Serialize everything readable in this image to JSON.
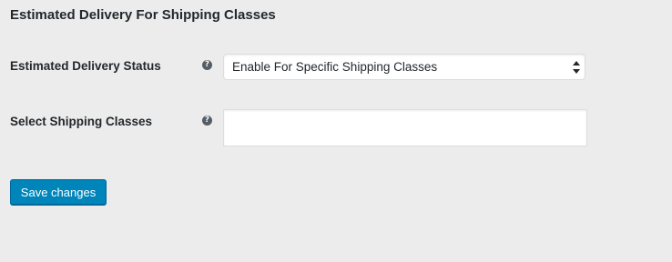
{
  "section": {
    "title": "Estimated Delivery For Shipping Classes"
  },
  "fields": [
    {
      "label": "Estimated Delivery Status",
      "help_icon": "question-circle-icon",
      "type": "select",
      "value": "Enable For Specific Shipping Classes"
    },
    {
      "label": "Select Shipping Classes",
      "help_icon": "question-circle-icon",
      "type": "multiselect",
      "value": ""
    }
  ],
  "actions": {
    "save_label": "Save changes"
  },
  "colors": {
    "primary_button": "#0085ba",
    "background": "#ececec"
  }
}
